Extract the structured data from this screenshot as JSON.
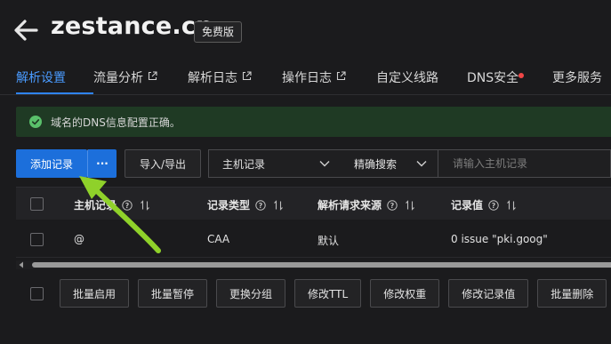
{
  "header": {
    "domain": "zestance.cn",
    "plan_badge": "免费版",
    "back_icon": "back-arrow-icon"
  },
  "tabs": [
    {
      "label": "解析设置",
      "active": true,
      "external": false
    },
    {
      "label": "流量分析",
      "active": false,
      "external": true
    },
    {
      "label": "解析日志",
      "active": false,
      "external": true
    },
    {
      "label": "操作日志",
      "active": false,
      "external": true
    },
    {
      "label": "自定义线路",
      "active": false,
      "external": false
    },
    {
      "label": "DNS安全",
      "active": false,
      "external": false,
      "dot": true
    },
    {
      "label": "更多服务",
      "active": false,
      "external": false
    }
  ],
  "alert": {
    "text": "域名的DNS信息配置正确。",
    "icon": "check-circle-icon",
    "color": "#1f3a24"
  },
  "toolbar": {
    "add_record": "添加记录",
    "more": "···",
    "import_export": "导入/导出",
    "field_select": "主机记录",
    "search_mode": "精确搜索",
    "search_placeholder": "请输入主机记录"
  },
  "table": {
    "columns": [
      "主机记录",
      "记录类型",
      "解析请求来源",
      "记录值"
    ],
    "rows": [
      {
        "host": "@",
        "type": "CAA",
        "source": "默认",
        "value": "0 issue \"pki.goog\""
      }
    ]
  },
  "bulk_actions": [
    "批量启用",
    "批量暂停",
    "更换分组",
    "修改TTL",
    "修改权重",
    "修改记录值",
    "批量删除"
  ],
  "colors": {
    "accent": "#1c6fdb",
    "tab_active": "#4a9bff",
    "annotation_arrow": "#8fd12a",
    "dot": "#f04646"
  }
}
